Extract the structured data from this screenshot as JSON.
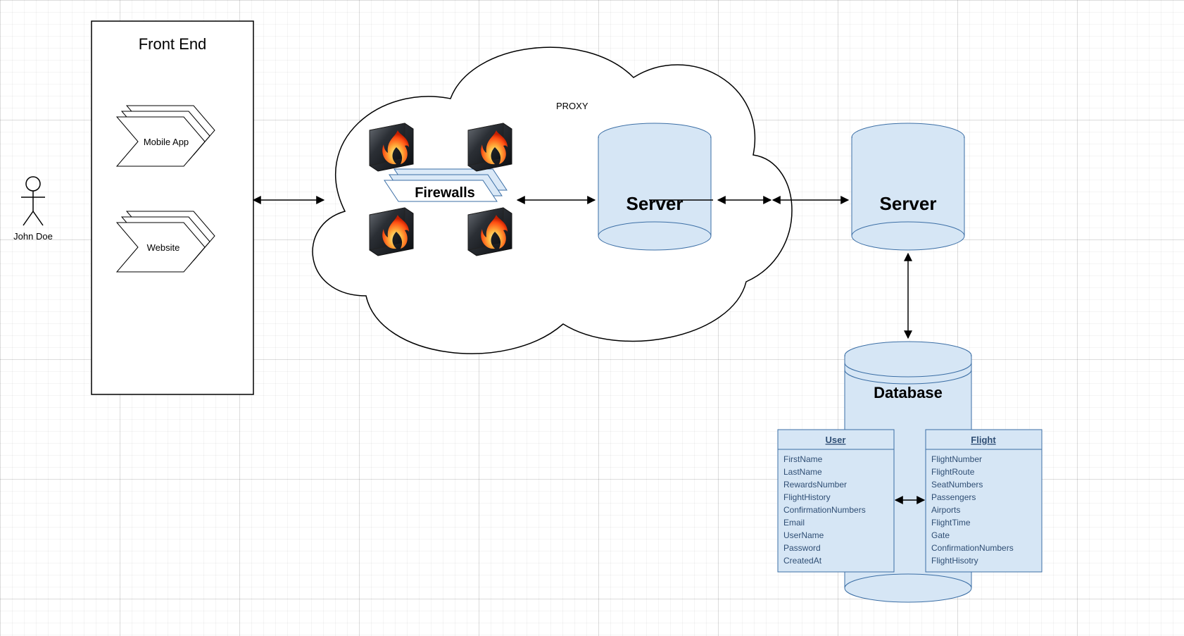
{
  "actor": {
    "name": "John Doe"
  },
  "frontend": {
    "title": "Front End",
    "mobile": "Mobile App",
    "website": "Website"
  },
  "cloud": {
    "proxyLabel": "PROXY",
    "firewalls": "Firewalls",
    "server": "Server"
  },
  "server2": "Server",
  "database": {
    "title": "Database"
  },
  "tables": {
    "user": {
      "title": "User",
      "fields": [
        "FirstName",
        "LastName",
        "RewardsNumber",
        "FlightHistory",
        "ConfirmationNumbers",
        "Email",
        "UserName",
        "Password",
        "CreatedAt"
      ]
    },
    "flight": {
      "title": "Flight",
      "fields": [
        "FlightNumber",
        "FlightRoute",
        "SeatNumbers",
        "Passengers",
        "Airports",
        "FlightTime",
        "Gate",
        "ConfirmationNumbers",
        "FlightHisotry"
      ]
    }
  }
}
